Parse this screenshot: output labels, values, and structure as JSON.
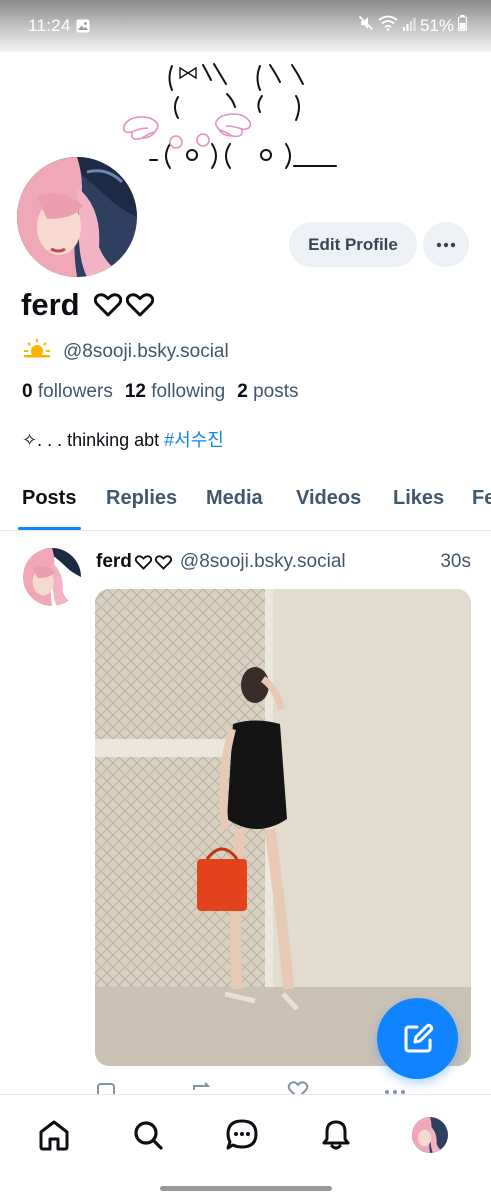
{
  "status_bar": {
    "time": "11:24",
    "battery": "51%"
  },
  "profile": {
    "display_name": "ferd",
    "name_icons": [
      "heart-outline",
      "heart-outline"
    ],
    "handle": "@8sooji.bsky.social",
    "handle_icon": "sun-behind-cloud-icon",
    "followers_count": "0",
    "followers_label": "followers",
    "following_count": "12",
    "following_label": "following",
    "posts_count": "2",
    "posts_label": "posts",
    "bio_prefix": "✧. . . thinking abt",
    "bio_hashtag": "#서수진",
    "edit_label": "Edit Profile"
  },
  "tabs": [
    {
      "label": "Posts",
      "active": true
    },
    {
      "label": "Replies"
    },
    {
      "label": "Media"
    },
    {
      "label": "Videos"
    },
    {
      "label": "Likes"
    },
    {
      "label": "Feeds"
    }
  ],
  "post": {
    "author": "ferd",
    "handle": "@8sooji.bsky.social",
    "time": "30s"
  },
  "bottom_nav": [
    "home-icon",
    "search-icon",
    "chat-icon",
    "bell-icon",
    "profile-avatar"
  ],
  "colors": {
    "accent": "#1083fe",
    "muted": "#42576c",
    "button_bg": "#eef1f5"
  }
}
